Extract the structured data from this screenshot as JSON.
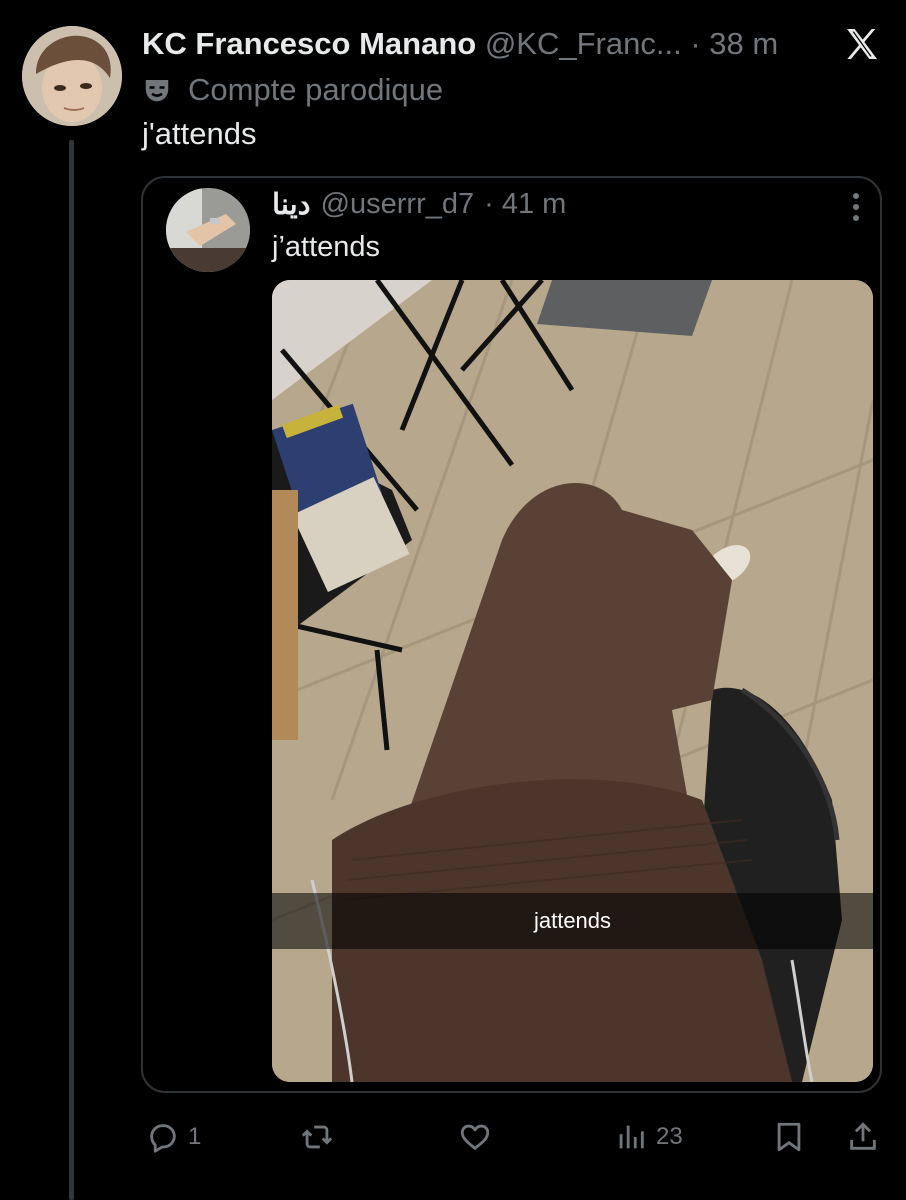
{
  "tweet": {
    "display_name": "KC Francesco Manano",
    "handle": "@KC_Franc...",
    "time": "· 38 m",
    "parody_label": "Compte parodique",
    "text": "j'attends"
  },
  "quote": {
    "display_name": "دينا",
    "handle": "@userrr_d7",
    "time": "· 41 m",
    "text": "j’attends",
    "media_caption": "jattends"
  },
  "actions": {
    "reply_count": "1",
    "views_count": "23"
  },
  "icons": {
    "x_logo": "x-logo-icon",
    "parody": "mask-icon",
    "more": "more-icon",
    "reply": "reply-icon",
    "repost": "repost-icon",
    "like": "like-icon",
    "views": "views-icon",
    "bookmark": "bookmark-icon",
    "share": "share-icon"
  },
  "colors": {
    "background": "#000000",
    "text_primary": "#e7e9ea",
    "text_secondary": "#71767b",
    "border": "#2f3336"
  }
}
